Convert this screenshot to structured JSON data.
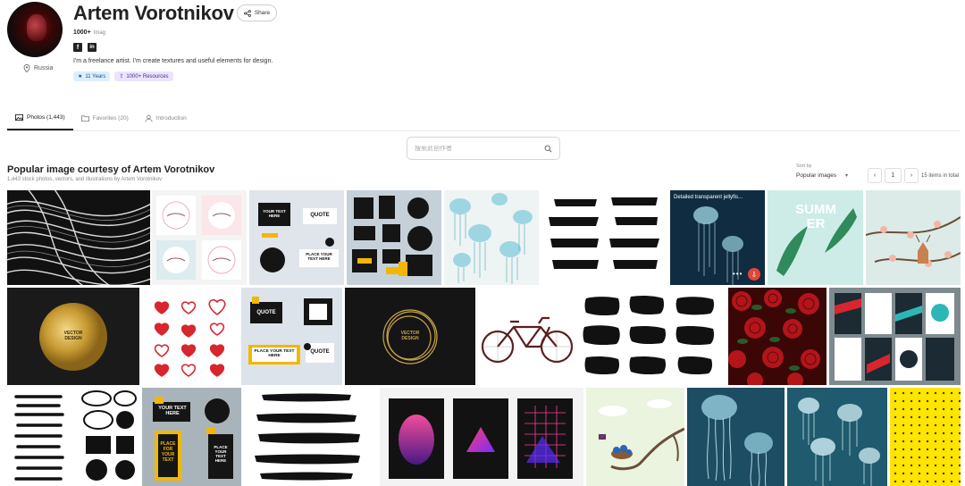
{
  "profile": {
    "name": "Artem Vorotnikov",
    "location": "Russia",
    "share_label": "Share",
    "count": "1000+",
    "count_label": "Imag",
    "bio": "I'm a freelance artist. I'm create textures and useful elements for design.",
    "badges": {
      "years": "11 Years",
      "resources": "1000+ Resources"
    },
    "socials": [
      "facebook-icon",
      "linkedin-icon"
    ]
  },
  "tabs": [
    {
      "label": "Photos (1,443)",
      "icon": "image-icon",
      "active": true
    },
    {
      "label": "Favorites (20)",
      "icon": "folder-icon",
      "active": false
    },
    {
      "label": "Introduction",
      "icon": "user-icon",
      "active": false
    }
  ],
  "search": {
    "placeholder": "搜索此创作者"
  },
  "section": {
    "title": "Popular image courtesy of Artem Vorotnikov",
    "subtitle": "1,443 stock photos, vectors, and illustrations by Artem Vorotnikov"
  },
  "sort": {
    "label": "Sort by",
    "selected": "Popular images"
  },
  "pagination": {
    "prev": "‹",
    "page": "1",
    "next": "›",
    "total": "15 items in total"
  },
  "tiles": {
    "t4_lines": [
      "YOUR TEXT HERE",
      "QUOTE",
      "PLACE YOUR TEXT HERE"
    ],
    "t7_title": "Detailed transparent jellyfis...",
    "t8_word": "SUMMER",
    "t10_text": "VECTOR DESIGN",
    "t12_lines": [
      "QUOTE",
      "PLACE YOUR TEXT HERE",
      "QUOTE"
    ],
    "t13_text": "VECTOR DESIGN",
    "t19_lines": [
      "YOUR TEXT HERE",
      "PLACE FOR YOUR TEXT",
      "PLACE YOUR TEXT HERE"
    ]
  },
  "colors": {
    "accent_download": "#e4453a",
    "badge_years_bg": "#dcefff",
    "badge_resources_bg": "#ece4ff"
  }
}
